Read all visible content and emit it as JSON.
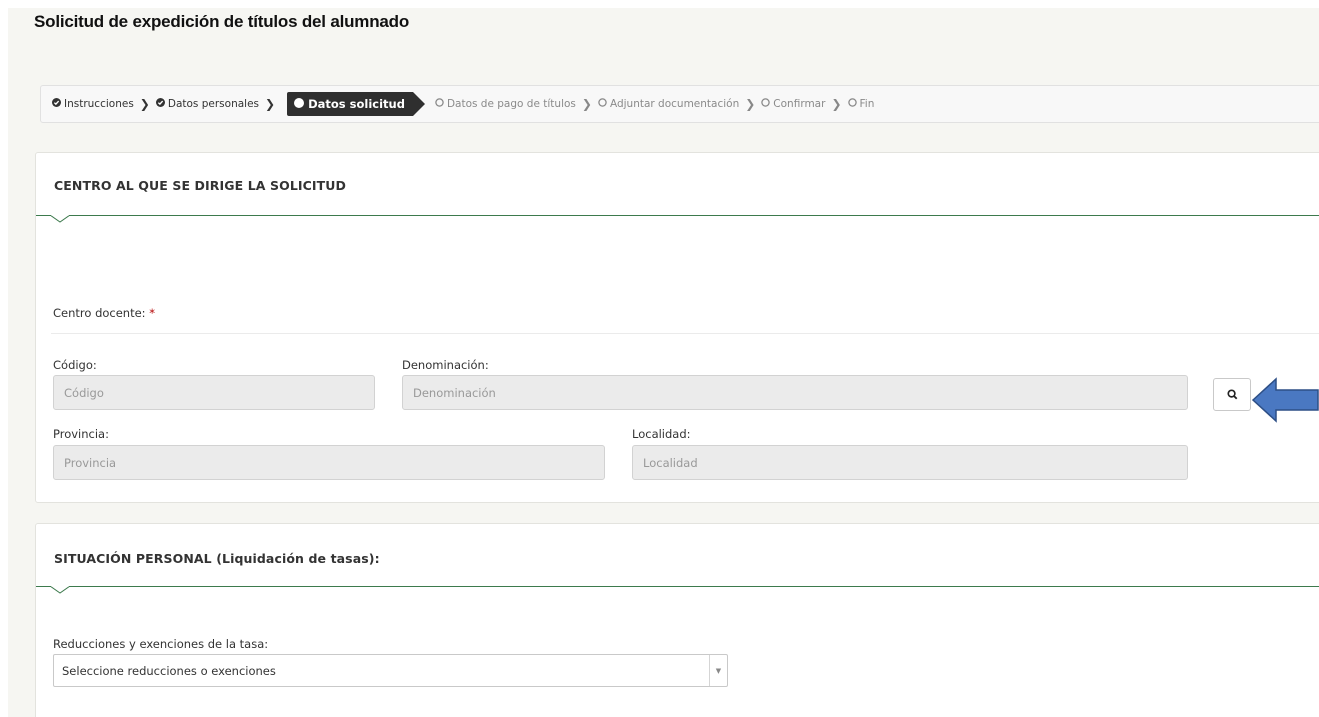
{
  "page": {
    "title": "Solicitud de expedición de títulos del alumnado"
  },
  "steps": {
    "items": [
      {
        "label": "Instrucciones",
        "state": "done",
        "icon": "check-circle-icon"
      },
      {
        "label": "Datos personales",
        "state": "done",
        "icon": "check-circle-icon"
      },
      {
        "label": "Datos solicitud",
        "state": "active",
        "icon": "filled-circle-icon"
      },
      {
        "label": "Datos de pago de títulos",
        "state": "pending",
        "icon": "empty-circle-icon"
      },
      {
        "label": "Adjuntar documentación",
        "state": "pending",
        "icon": "empty-circle-icon"
      },
      {
        "label": "Confirmar",
        "state": "pending",
        "icon": "empty-circle-icon"
      },
      {
        "label": "Fin",
        "state": "pending",
        "icon": "empty-circle-icon"
      }
    ],
    "separator": "❯"
  },
  "centro": {
    "title": "CENTRO AL QUE SE DIRIGE LA SOLICITUD",
    "centro_docente_label": "Centro docente:",
    "required_mark": "*",
    "codigo": {
      "label": "Código:",
      "placeholder": "Código",
      "value": ""
    },
    "denominacion": {
      "label": "Denominación:",
      "placeholder": "Denominación",
      "value": ""
    },
    "provincia": {
      "label": "Provincia:",
      "placeholder": "Provincia",
      "value": ""
    },
    "localidad": {
      "label": "Localidad:",
      "placeholder": "Localidad",
      "value": ""
    },
    "search_icon": "magnifier-icon"
  },
  "situacion": {
    "title": "SITUACIÓN PERSONAL (Liquidación de tasas):",
    "reducciones_label": "Reducciones y exenciones de la tasa:",
    "reducciones_selected": "Seleccione reducciones o exenciones"
  },
  "colors": {
    "accent_green": "#3d7a4d",
    "active_step_bg": "#2f2f2f",
    "annotation_arrow": "#4a78c2",
    "required": "#b30000"
  }
}
